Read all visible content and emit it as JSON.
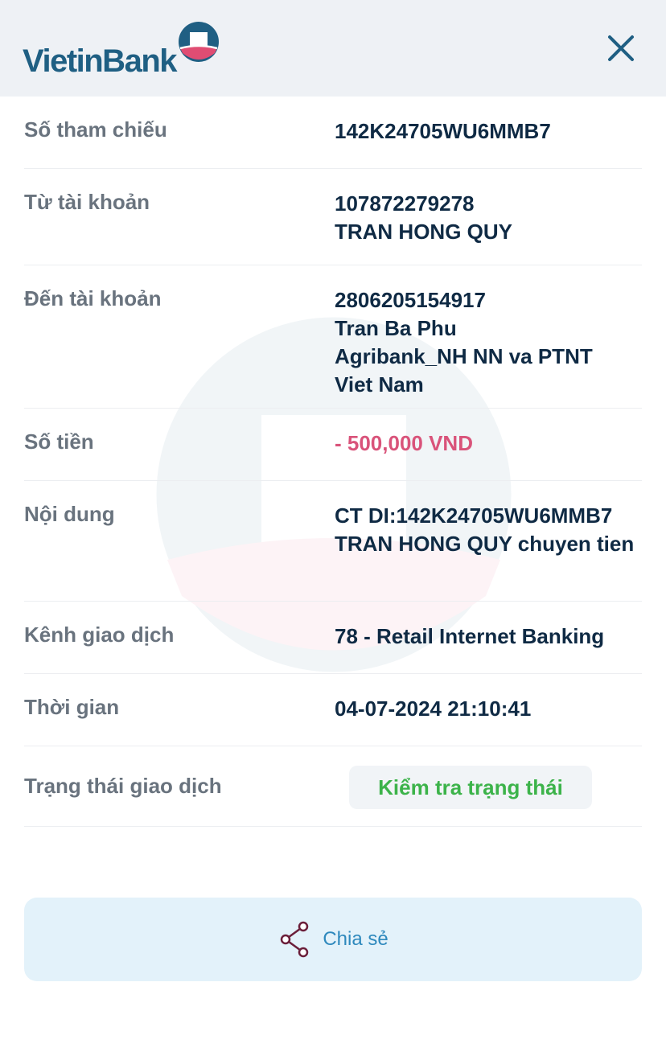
{
  "brand": {
    "name": "VietinBank",
    "colors": {
      "primary": "#1f5f83",
      "accent": "#e04d73",
      "status_green": "#3cb34a",
      "share_bg": "#e3f2fa"
    }
  },
  "header": {
    "close_icon": "close-icon"
  },
  "details": [
    {
      "label": "Số tham chiếu",
      "lines": [
        "142K24705WU6MMB7"
      ]
    },
    {
      "label": "Từ tài khoản",
      "lines": [
        "107872279278",
        "TRAN HONG QUY"
      ]
    },
    {
      "label": "Đến tài khoản",
      "lines": [
        "2806205154917",
        "Tran Ba Phu",
        "Agribank_NH NN va PTNT",
        "Viet Nam"
      ]
    },
    {
      "label": "Số tiền",
      "lines": [
        "- 500,000 VND"
      ]
    },
    {
      "label": "Nội dung",
      "lines": [
        "CT DI:142K24705WU6MMB7",
        "TRAN HONG QUY chuyen tien"
      ]
    },
    {
      "label": "Kênh giao dịch",
      "lines": [
        "78 - Retail Internet Banking"
      ]
    },
    {
      "label": "Thời gian",
      "lines": [
        "04-07-2024 21:10:41"
      ]
    },
    {
      "label": "Trạng thái giao dịch",
      "button": "Kiểm tra trạng thái"
    }
  ],
  "share": {
    "label": "Chia sẻ",
    "icon": "share-icon"
  }
}
